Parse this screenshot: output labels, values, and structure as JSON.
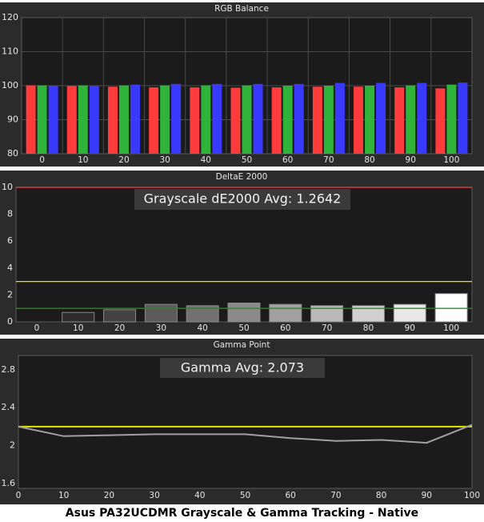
{
  "caption": "Asus PA32UCDMR Grayscale & Gamma Tracking - Native",
  "colors": {
    "panel_bg": "#2b2b2b",
    "plot_bg": "#1b1b1b",
    "grid": "#4a4a4a",
    "text": "#e6e6e6",
    "red": "#ff3b3b",
    "green": "#2fb33a",
    "blue": "#3a3aff",
    "yellow": "#e6e600",
    "limit_line": "#ff4040",
    "target_green": "#1f8f1f",
    "gamma_line": "#a0a0a0"
  },
  "chart_data": [
    {
      "type": "bar",
      "title": "RGB Balance",
      "categories": [
        "0",
        "10",
        "20",
        "30",
        "40",
        "50",
        "60",
        "70",
        "80",
        "90",
        "100"
      ],
      "ylim": [
        80,
        120
      ],
      "yticks": [
        80,
        90,
        100,
        110,
        120
      ],
      "grid": true,
      "series": [
        {
          "color": "red",
          "values": [
            100.1,
            99.9,
            99.7,
            99.5,
            99.5,
            99.4,
            99.5,
            99.7,
            99.7,
            99.5,
            99.2
          ]
        },
        {
          "color": "green",
          "values": [
            100.1,
            100.1,
            100.1,
            100.1,
            100.1,
            100.1,
            100.0,
            100.0,
            100.0,
            100.1,
            100.3
          ]
        },
        {
          "color": "blue",
          "values": [
            100.0,
            99.9,
            100.3,
            100.5,
            100.5,
            100.5,
            100.5,
            100.8,
            100.8,
            100.8,
            100.9
          ]
        }
      ]
    },
    {
      "type": "bar",
      "title": "DeltaE 2000",
      "annotation": "Grayscale dE2000 Avg: 1.2642",
      "categories": [
        "0",
        "10",
        "20",
        "30",
        "40",
        "50",
        "60",
        "70",
        "80",
        "90",
        "100"
      ],
      "ylim": [
        0,
        10
      ],
      "yticks": [
        0,
        2,
        4,
        6,
        8,
        10
      ],
      "grid": false,
      "values": [
        0.0,
        0.7,
        0.9,
        1.3,
        1.2,
        1.4,
        1.3,
        1.2,
        1.2,
        1.3,
        2.1
      ],
      "reference_lines": [
        {
          "y": 10,
          "color": "limit_line"
        },
        {
          "y": 3,
          "color": "yellow"
        },
        {
          "y": 1,
          "color": "target_green"
        }
      ]
    },
    {
      "type": "line",
      "title": "Gamma Point",
      "annotation": "Gamma Avg: 2.073",
      "x": [
        0,
        10,
        20,
        30,
        40,
        50,
        60,
        70,
        80,
        90,
        100
      ],
      "xticks": [
        0,
        10,
        20,
        30,
        40,
        50,
        60,
        70,
        80,
        90,
        100
      ],
      "y": [
        2.2,
        2.1,
        2.11,
        2.12,
        2.12,
        2.12,
        2.08,
        2.05,
        2.06,
        2.03,
        2.22
      ],
      "ylim": [
        1.55,
        2.95
      ],
      "yticks": [
        1.6,
        2,
        2.4,
        2.8
      ],
      "ytick_labels": [
        "1.6",
        "2",
        "2.4",
        "2.8"
      ],
      "target": 2.2,
      "grid": false
    }
  ]
}
